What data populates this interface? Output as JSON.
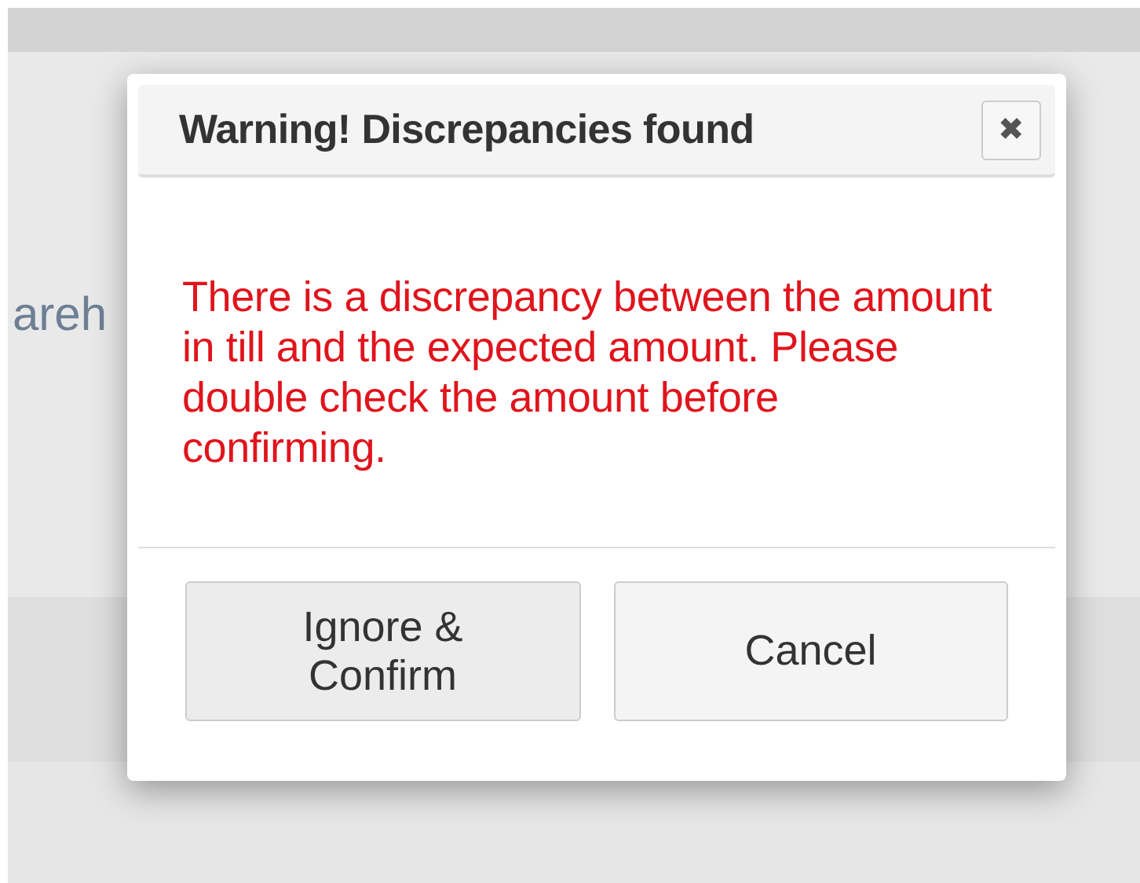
{
  "background": {
    "label": "areh"
  },
  "dialog": {
    "title": "Warning! Discrepancies found",
    "close": "✖",
    "message": "There is a discrepancy between the amount in till and the expected amount. Please double check the amount before confirming.",
    "buttons": [
      {
        "label": "Ignore & Confirm",
        "kind": "primary"
      },
      {
        "label": "Cancel",
        "kind": "secondary"
      }
    ]
  }
}
